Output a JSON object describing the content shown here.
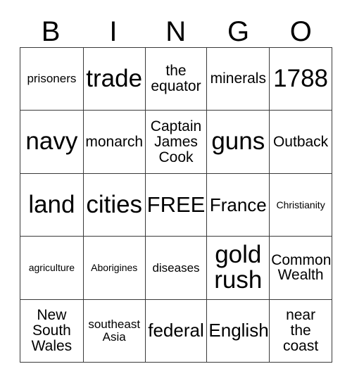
{
  "card": {
    "header_letters": [
      "B",
      "I",
      "N",
      "G",
      "O"
    ],
    "free_space_label": "FREE",
    "rows": [
      [
        {
          "text": "prisoners",
          "size": "fs-sm"
        },
        {
          "text": "trade",
          "size": "fs-xxl"
        },
        {
          "text": "the\nequator",
          "size": "fs-md"
        },
        {
          "text": "minerals",
          "size": "fs-md"
        },
        {
          "text": "1788",
          "size": "fs-xxl"
        }
      ],
      [
        {
          "text": "navy",
          "size": "fs-xxl"
        },
        {
          "text": "monarch",
          "size": "fs-md"
        },
        {
          "text": "Captain\nJames\nCook",
          "size": "fs-md"
        },
        {
          "text": "guns",
          "size": "fs-xxl"
        },
        {
          "text": "Outback",
          "size": "fs-md"
        }
      ],
      [
        {
          "text": "land",
          "size": "fs-xxl"
        },
        {
          "text": "cities",
          "size": "fs-xxl"
        },
        {
          "text": "FREE",
          "size": "fs-xl"
        },
        {
          "text": "France",
          "size": "fs-lg"
        },
        {
          "text": "Christianity",
          "size": "fs-xs"
        }
      ],
      [
        {
          "text": "agriculture",
          "size": "fs-xs"
        },
        {
          "text": "Aborigines",
          "size": "fs-xs"
        },
        {
          "text": "diseases",
          "size": "fs-sm"
        },
        {
          "text": "gold\nrush",
          "size": "fs-xxl"
        },
        {
          "text": "Common\nWealth",
          "size": "fs-md"
        }
      ],
      [
        {
          "text": "New\nSouth\nWales",
          "size": "fs-md"
        },
        {
          "text": "southeast\nAsia",
          "size": "fs-sm"
        },
        {
          "text": "federal",
          "size": "fs-lg"
        },
        {
          "text": "English",
          "size": "fs-lg"
        },
        {
          "text": "near\nthe\ncoast",
          "size": "fs-md"
        }
      ]
    ]
  },
  "colors": {
    "background": "#ffffff",
    "grid_line": "#3a3a3a",
    "text": "#000000"
  }
}
